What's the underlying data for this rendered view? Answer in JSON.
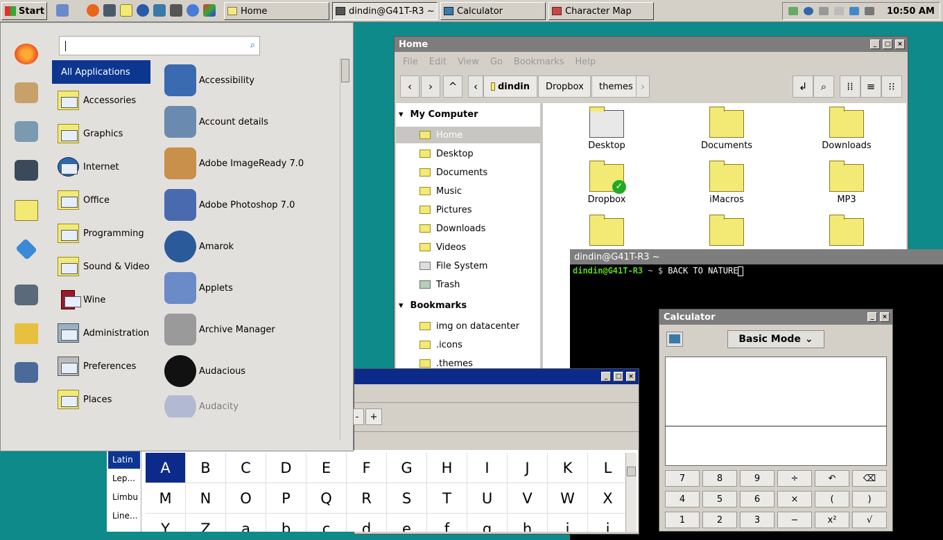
{
  "taskbar": {
    "start_label": "Start",
    "tasks": [
      {
        "label": "Home"
      },
      {
        "label": "dindin@G41T-R3 ~"
      },
      {
        "label": "Calculator"
      },
      {
        "label": "Character Map"
      }
    ],
    "clock": "10:50 AM"
  },
  "menu": {
    "search": {
      "value": "",
      "placeholder": ""
    },
    "all_apps": "All Applications",
    "categories": [
      "Accessories",
      "Graphics",
      "Internet",
      "Office",
      "Programming",
      "Sound & Video",
      "Wine",
      "Administration",
      "Preferences",
      "Places"
    ],
    "apps": [
      "Accessibility",
      "Account details",
      "Adobe ImageReady 7.0",
      "Adobe Photoshop 7.0",
      "Amarok",
      "Applets",
      "Archive Manager",
      "Audacious",
      "Audacity"
    ]
  },
  "file_manager": {
    "title": "Home",
    "menubar": [
      "File",
      "Edit",
      "View",
      "Go",
      "Bookmarks",
      "Help"
    ],
    "breadcrumb": [
      "dindin",
      "Dropbox",
      "themes"
    ],
    "sidebar": {
      "my_computer": "My Computer",
      "computer_items": [
        "Home",
        "Desktop",
        "Documents",
        "Music",
        "Pictures",
        "Downloads",
        "Videos",
        "File System",
        "Trash"
      ],
      "bookmarks": "Bookmarks",
      "bookmark_items": [
        "img on datacenter",
        ".icons",
        ".themes"
      ]
    },
    "items": [
      "Desktop",
      "Documents",
      "Downloads",
      "Dropbox",
      "iMacros",
      "MP3"
    ]
  },
  "terminal": {
    "title": "dindin@G41T-R3 ~",
    "prompt_user": "dindin@G41T-R3",
    "prompt_path": " ~ $ ",
    "command": "BACK TO NATURE"
  },
  "charmap": {
    "zoom_minus": "-",
    "zoom_plus": "+",
    "scripts": [
      "Latin",
      "Lep...",
      "Limbu",
      "Line..."
    ],
    "chars_row1": [
      "A",
      "B",
      "C",
      "D",
      "E",
      "F",
      "G",
      "H",
      "I",
      "J",
      "K",
      "L"
    ],
    "chars_row2": [
      "M",
      "N",
      "O",
      "P",
      "Q",
      "R",
      "S",
      "T",
      "U",
      "V",
      "W",
      "X"
    ],
    "chars_row3": [
      "Y",
      "Z",
      "a",
      "b",
      "c",
      "d",
      "e",
      "f",
      "g",
      "h",
      "i",
      "j"
    ]
  },
  "calculator": {
    "title": "Calculator",
    "mode": "Basic Mode",
    "keys": [
      [
        "7",
        "8",
        "9",
        "÷",
        "↶",
        "⌫"
      ],
      [
        "4",
        "5",
        "6",
        "×",
        "(",
        ")"
      ],
      [
        "1",
        "2",
        "3",
        "−",
        "x²",
        "√"
      ]
    ]
  },
  "colors": {
    "desktop": "#0f8a8a",
    "selection": "#0c3690",
    "titlebar_inactive": "#7d7d7d"
  }
}
